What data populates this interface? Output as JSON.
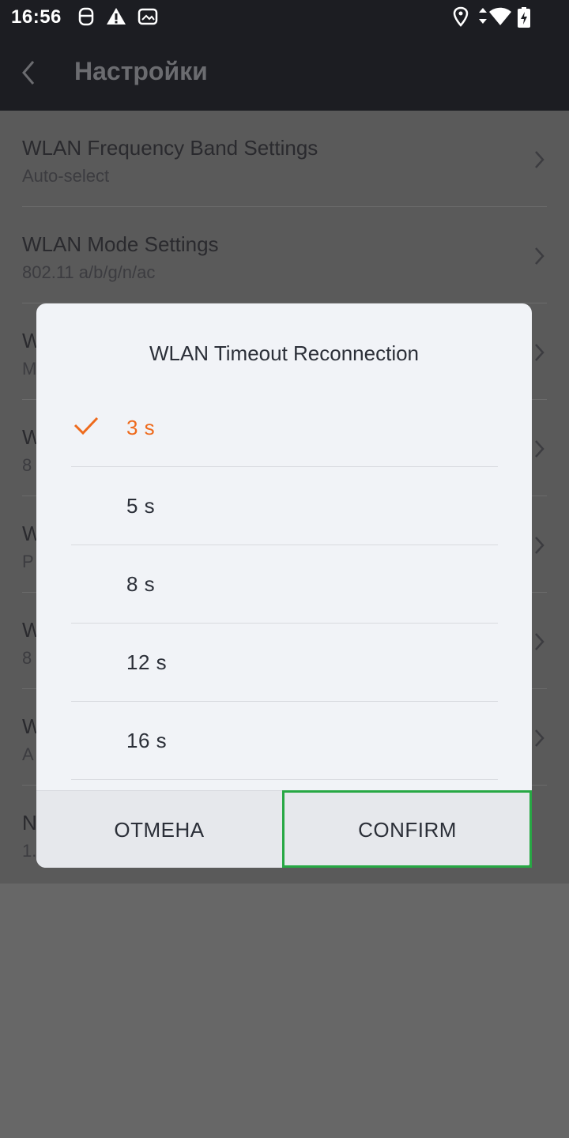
{
  "status_bar": {
    "time": "16:56",
    "left_icons": [
      "notification-app-icon",
      "warning-icon",
      "gallery-icon"
    ],
    "right_icons": [
      "location-icon",
      "data-arrows-icon",
      "wifi-icon",
      "battery-charging-icon"
    ]
  },
  "app_bar": {
    "back_icon": "chevron-left-icon",
    "title": "Настройки"
  },
  "settings": [
    {
      "title": "WLAN Frequency Band Settings",
      "subtitle": "Auto-select"
    },
    {
      "title": "WLAN Mode Settings",
      "subtitle": "802.11 a/b/g/n/ac"
    },
    {
      "title": "W",
      "subtitle": "M"
    },
    {
      "title": "W",
      "subtitle": "8"
    },
    {
      "title": "W",
      "subtitle": "P"
    },
    {
      "title": "W",
      "subtitle": "8"
    },
    {
      "title": "W",
      "subtitle": "A"
    },
    {
      "title": "N",
      "subtitle": "1."
    }
  ],
  "dialog": {
    "title": "WLAN Timeout Reconnection",
    "options": [
      {
        "label": "3 s",
        "selected": true
      },
      {
        "label": "5 s",
        "selected": false
      },
      {
        "label": "8 s",
        "selected": false
      },
      {
        "label": "12 s",
        "selected": false
      },
      {
        "label": "16 s",
        "selected": false
      }
    ],
    "cancel_label": "ОТМЕНА",
    "confirm_label": "CONFIRM"
  },
  "colors": {
    "accent": "#ee6a1c",
    "highlight": "#27a844",
    "bar": "#1c1d22"
  }
}
